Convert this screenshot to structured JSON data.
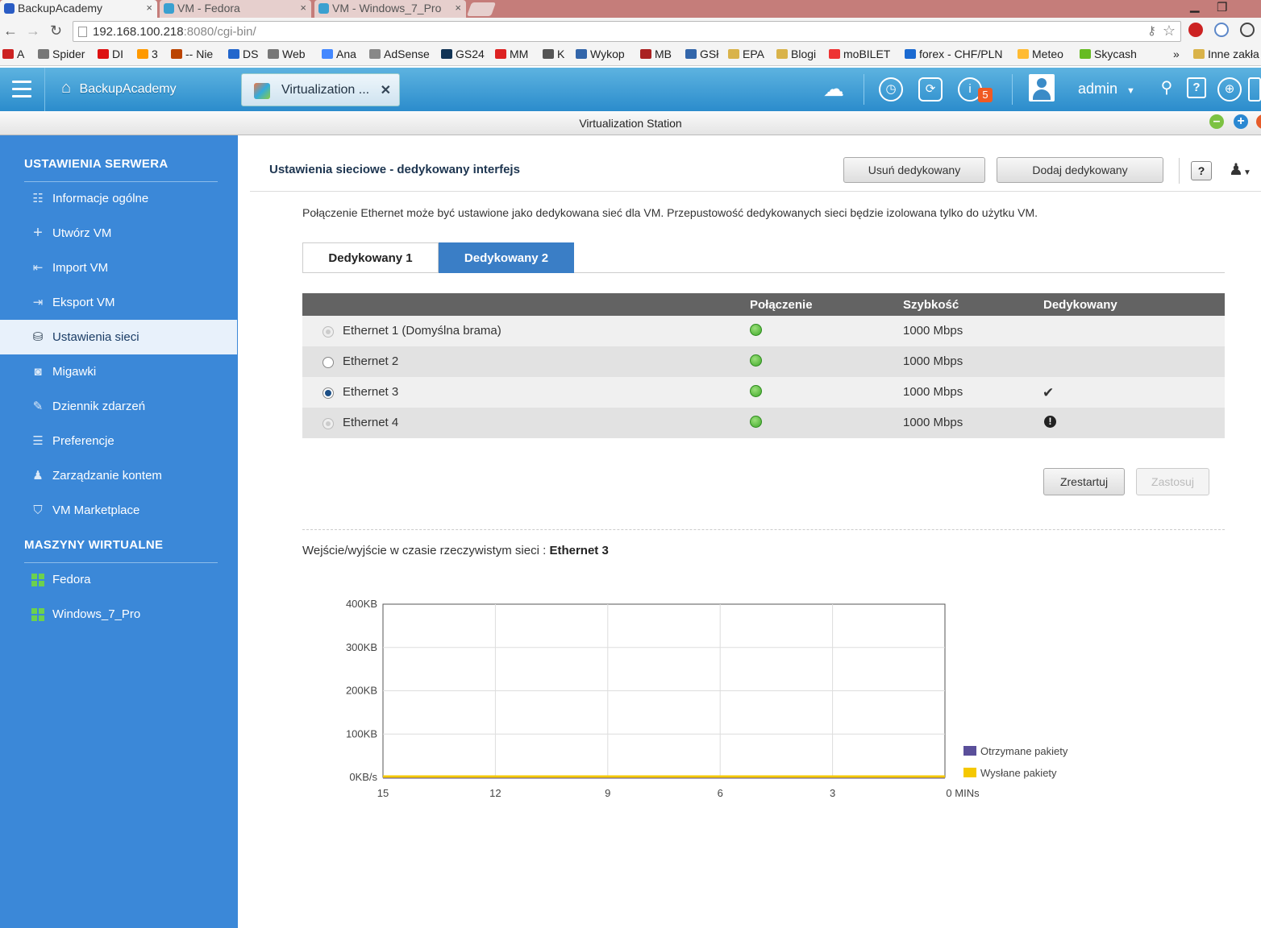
{
  "browser": {
    "tabs": [
      {
        "title": "BackupAcademy",
        "icon_color": "#2a5cc4"
      },
      {
        "title": "VM - Fedora",
        "icon_color": "#3aa0d0"
      },
      {
        "title": "VM - Windows_7_Pro",
        "icon_color": "#3aa0d0"
      }
    ],
    "close_glyph": "×",
    "url_host": "192.168.100.218",
    "url_rest": ":8080/cgi-bin/",
    "bookmarks": [
      {
        "label": "A",
        "color": "#c22"
      },
      {
        "label": "Spider",
        "color": "#777"
      },
      {
        "label": "DI",
        "color": "#d11"
      },
      {
        "label": "3",
        "color": "#f90"
      },
      {
        "label": "-- Nie",
        "color": "#b40"
      },
      {
        "label": "DS",
        "color": "#26c"
      },
      {
        "label": "Web",
        "color": "#777"
      },
      {
        "label": "Ana",
        "color": "#48f"
      },
      {
        "label": "AdSense",
        "color": "#888"
      },
      {
        "label": "GS24",
        "color": "#135"
      },
      {
        "label": "MM",
        "color": "#d22"
      },
      {
        "label": "K",
        "color": "#555"
      },
      {
        "label": "Wykop",
        "color": "#36a"
      },
      {
        "label": "MB",
        "color": "#a22"
      },
      {
        "label": "GSł",
        "color": "#36a"
      },
      {
        "label": "EPA",
        "color": "#d9b34a"
      },
      {
        "label": "Blogi",
        "color": "#d9b34a"
      },
      {
        "label": "moBILET",
        "color": "#e33"
      },
      {
        "label": "forex - CHF/PLN",
        "color": "#1b6ad1"
      },
      {
        "label": "Meteo",
        "color": "#fb3"
      },
      {
        "label": "Skycash",
        "color": "#6b2"
      }
    ],
    "bookmarks_more": "»",
    "other_bookmarks": "Inne zakła"
  },
  "app": {
    "home_label": "BackupAcademy",
    "open_tab_label": "Virtualization ...",
    "notification_count": "5",
    "user": "admin",
    "window_title": "Virtualization Station"
  },
  "sidebar": {
    "section_server": "USTAWIENIA SERWERA",
    "items": [
      {
        "label": "Informacje ogólne",
        "icon": "list-icon"
      },
      {
        "label": "Utwórz VM",
        "icon": "plus-icon"
      },
      {
        "label": "Import VM",
        "icon": "import-icon"
      },
      {
        "label": "Eksport VM",
        "icon": "export-icon"
      },
      {
        "label": "Ustawienia sieci",
        "icon": "network-icon"
      },
      {
        "label": "Migawki",
        "icon": "camera-icon"
      },
      {
        "label": "Dziennik zdarzeń",
        "icon": "log-icon"
      },
      {
        "label": "Preferencje",
        "icon": "preferences-icon"
      },
      {
        "label": "Zarządzanie kontem",
        "icon": "users-icon"
      },
      {
        "label": "VM Marketplace",
        "icon": "marketplace-icon"
      }
    ],
    "section_vms": "MASZYNY WIRTUALNE",
    "vms": [
      {
        "label": "Fedora"
      },
      {
        "label": "Windows_7_Pro"
      }
    ]
  },
  "main": {
    "title": "Ustawienia sieciowe - dedykowany interfejs",
    "remove_button": "Usuń dedykowany",
    "add_button": "Dodaj dedykowany",
    "help": "?",
    "description": "Połączenie Ethernet może być ustawione jako dedykowana sieć dla VM. Przepustowość dedykowanych sieci będzie izolowana tylko do użytku VM.",
    "tabs": [
      {
        "label": "Dedykowany 1",
        "selected": false
      },
      {
        "label": "Dedykowany 2",
        "selected": true
      }
    ],
    "table": {
      "headers": {
        "connection": "Połączenie",
        "speed": "Szybkość",
        "dedicated": "Dedykowany"
      },
      "rows": [
        {
          "name": "Ethernet 1 (Domyślna brama)",
          "radio": "disabled",
          "status": "connected",
          "speed": "1000 Mbps",
          "dedicated": ""
        },
        {
          "name": "Ethernet 2",
          "radio": "empty",
          "status": "connected",
          "speed": "1000 Mbps",
          "dedicated": ""
        },
        {
          "name": "Ethernet 3",
          "radio": "selected",
          "status": "connected",
          "speed": "1000 Mbps",
          "dedicated": "✔"
        },
        {
          "name": "Ethernet 4",
          "radio": "disabled",
          "status": "connected",
          "speed": "1000 Mbps",
          "dedicated": "!"
        }
      ]
    },
    "restart_button": "Zrestartuj",
    "apply_button": "Zastosuj",
    "realtime_label": "Wejście/wyjście w czasie rzeczywistym sieci :",
    "realtime_interface": "Ethernet 3"
  },
  "chart_data": {
    "type": "line",
    "x_ticks": [
      "15",
      "12",
      "9",
      "6",
      "3",
      "0 MINs"
    ],
    "y_ticks": [
      "0KB/s",
      "100KB",
      "200KB",
      "300KB",
      "400KB"
    ],
    "ylim": [
      0,
      400
    ],
    "xlim": [
      15,
      0
    ],
    "grid": true,
    "legend_position": "right",
    "series": [
      {
        "name": "Otrzymane pakiety",
        "color": "#5a4f9a",
        "values": [
          0,
          0
        ]
      },
      {
        "name": "Wysłane pakiety",
        "color": "#f5c800",
        "values": [
          0,
          0
        ]
      }
    ]
  }
}
